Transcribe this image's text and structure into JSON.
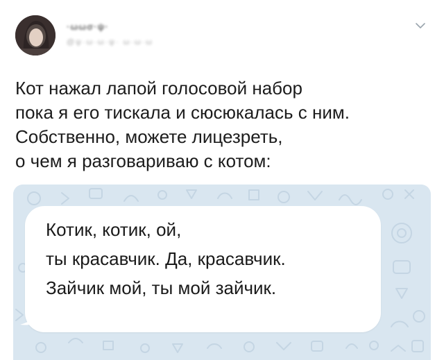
{
  "author": {
    "name": "·ωωσ·ψ·",
    "handle": "@ψ·ω·ω·ψ· ω·ω·ω"
  },
  "tweet": {
    "lines": [
      "Кот нажал лапой голосовой набор",
      "пока я его тискала и сюсюкалась с ним.",
      "Собственно, можете лицезреть,",
      "о чем я разговариваю с котом:"
    ]
  },
  "media": {
    "message_lines": [
      "Котик, котик, ой,",
      "ты красавчик. Да, красавчик.",
      "Зайчик мой, ты мой зайчик."
    ]
  },
  "colors": {
    "chat_background": "#d9e6f0",
    "bubble": "#ffffff",
    "text": "#1c1c1c"
  },
  "icons": {
    "menu": "chevron-down-icon"
  }
}
